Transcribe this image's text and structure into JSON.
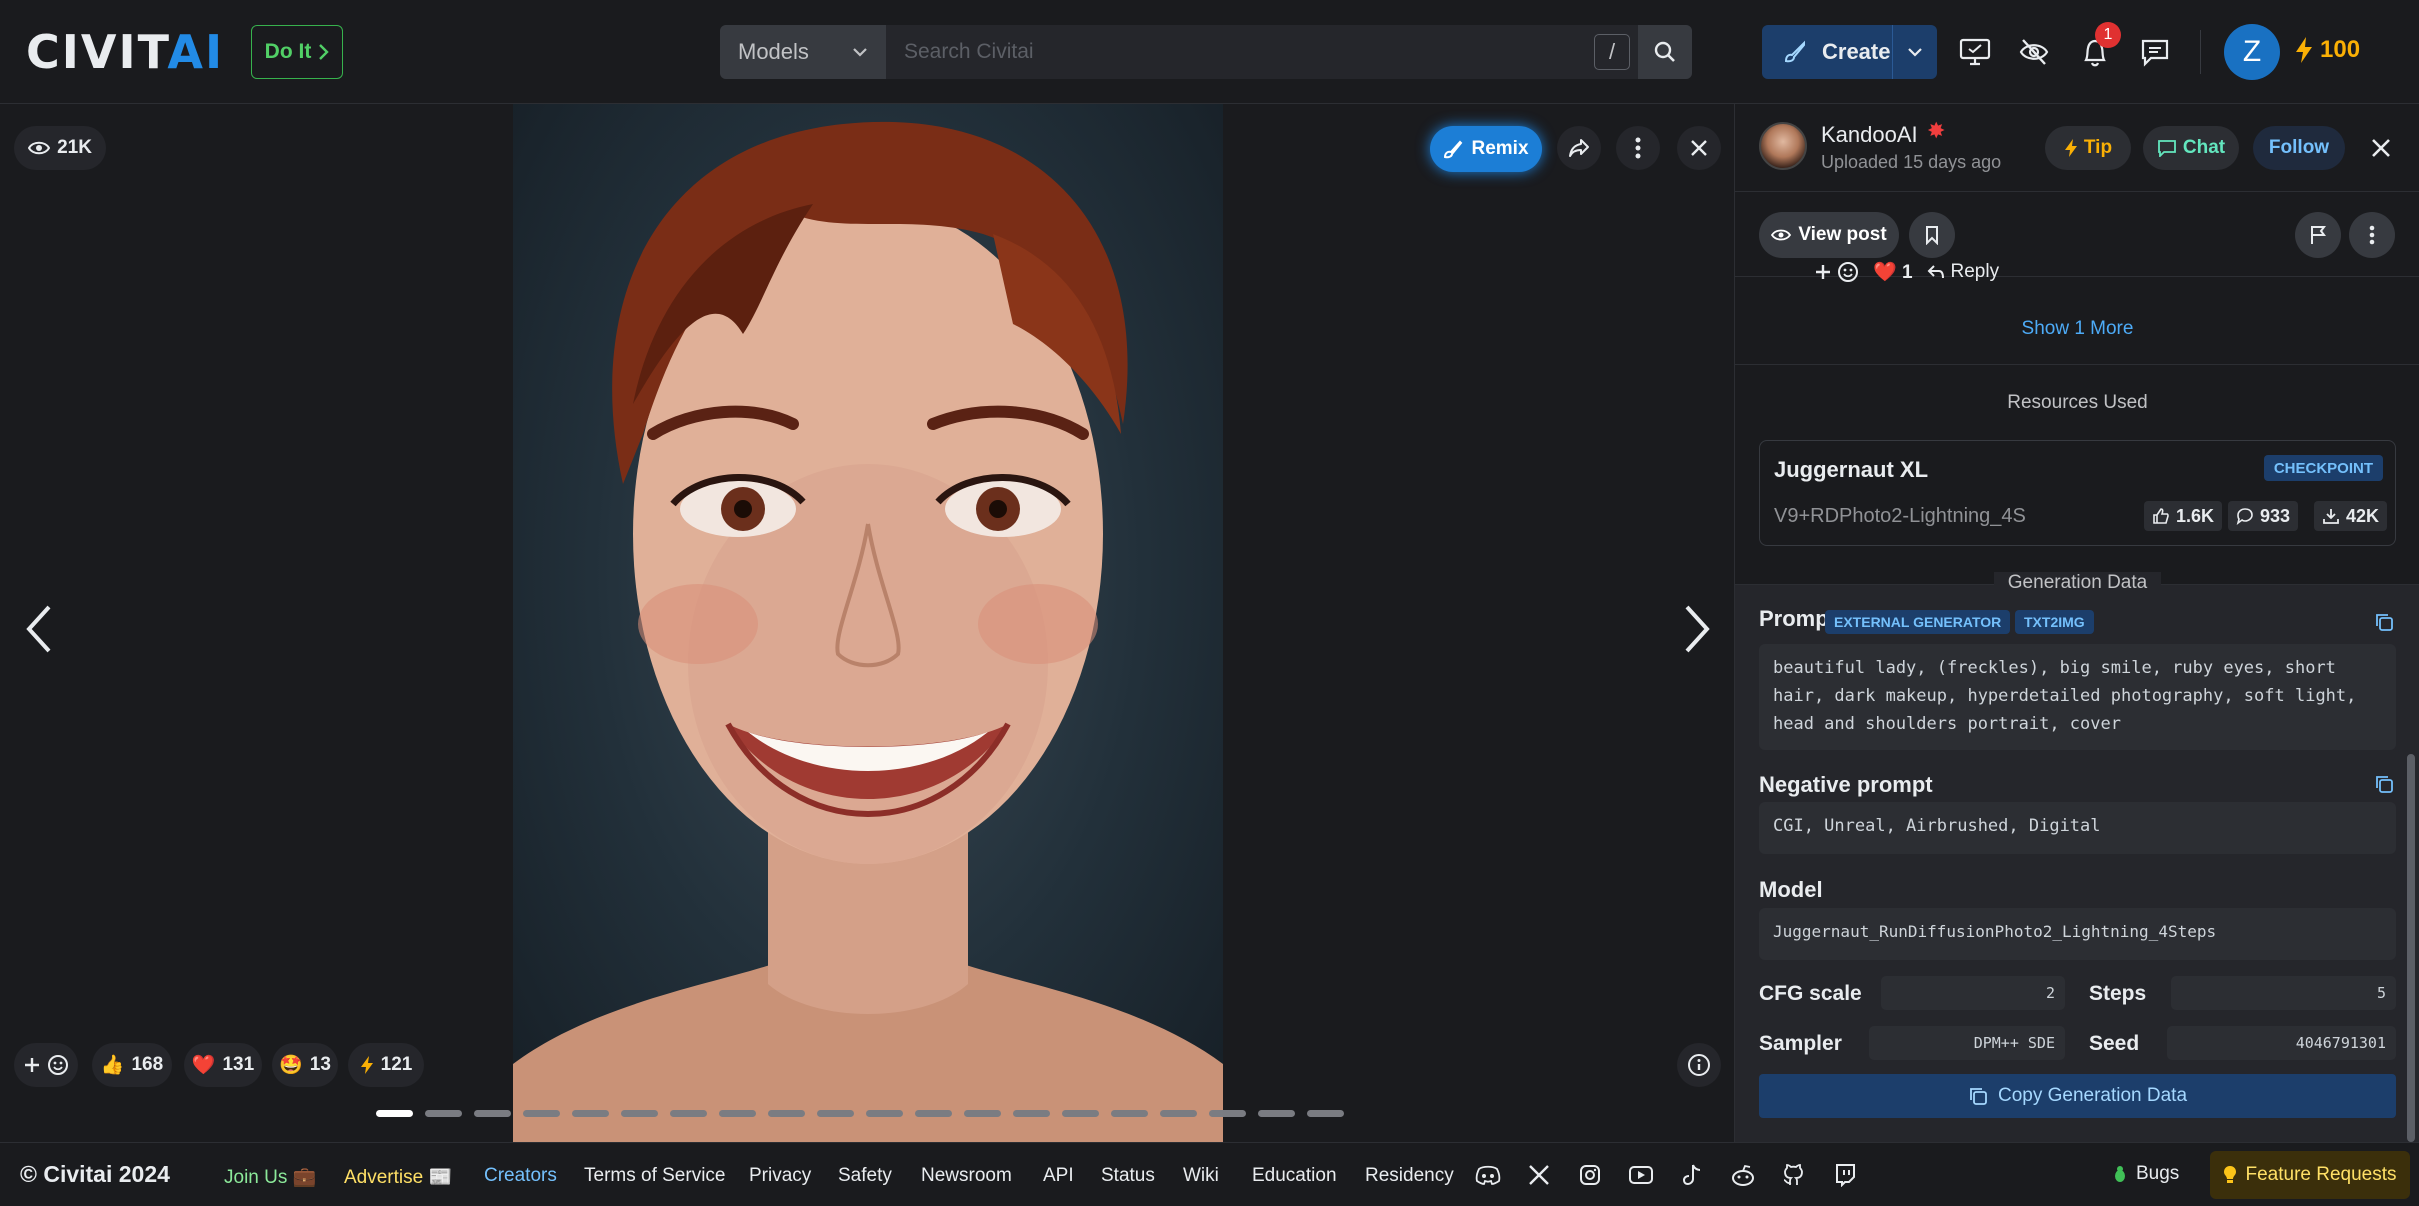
{
  "header": {
    "logo_part1": "CIVIT",
    "logo_part2": "AI",
    "doit_label": "Do It",
    "search_category": "Models",
    "search_placeholder": "Search Civitai",
    "search_shortcut": "/",
    "create_label": "Create",
    "notification_count": "1",
    "avatar_initial": "Z",
    "buzz_amount": "100"
  },
  "viewer": {
    "view_count": "21K",
    "remix_label": "Remix",
    "reactions": [
      {
        "emoji": "👍",
        "count": "168"
      },
      {
        "emoji": "❤️",
        "count": "131"
      },
      {
        "emoji": "🤩",
        "count": "13"
      },
      {
        "emoji": "⚡",
        "count": "121"
      }
    ],
    "dots_total": 20,
    "dots_active_index": 0
  },
  "sidebar": {
    "username": "KandooAI",
    "uploaded": "Uploaded 15 days ago",
    "tip_label": "Tip",
    "chat_label": "Chat",
    "follow_label": "Follow",
    "view_post_label": "View post",
    "comment_reaction_count": "1",
    "reply_label": "Reply",
    "show_more_label": "Show 1 More",
    "resources_title": "Resources Used",
    "resource": {
      "name": "Juggernaut XL",
      "type": "CHECKPOINT",
      "version": "V9+RDPhoto2-Lightning_4S",
      "likes": "1.6K",
      "comments": "933",
      "downloads": "42K"
    },
    "generation_title": "Generation Data",
    "prompt_label": "Prompt",
    "prompt_tags": [
      "EXTERNAL GENERATOR",
      "TXT2IMG"
    ],
    "prompt": "beautiful lady, (freckles), big smile, ruby eyes, short hair, dark makeup, hyperdetailed photography, soft light, head and shoulders portrait, cover",
    "negative_label": "Negative prompt",
    "negative_prompt": "CGI, Unreal, Airbrushed, Digital",
    "model_label": "Model",
    "model": "Juggernaut_RunDiffusionPhoto2_Lightning_4Steps",
    "cfg_label": "CFG scale",
    "cfg": "2",
    "steps_label": "Steps",
    "steps": "5",
    "sampler_label": "Sampler",
    "sampler": "DPM++ SDE",
    "seed_label": "Seed",
    "seed": "4046791301",
    "copy_gen_label": "Copy Generation Data"
  },
  "footer": {
    "copyright": "© Civitai 2024",
    "join_us": "Join Us 💼",
    "advertise": "Advertise 📰",
    "links": [
      "Creators",
      "Terms of Service",
      "Privacy",
      "Safety",
      "Newsroom",
      "API",
      "Status",
      "Wiki",
      "Education",
      "Residency"
    ],
    "bugs_label": "Bugs",
    "feature_label": "Feature Requests"
  },
  "colors": {
    "background": "#1a1b1e",
    "accent_blue": "#228be6",
    "buzz_yellow": "#fab005",
    "creators_link": "#74c0fc"
  }
}
